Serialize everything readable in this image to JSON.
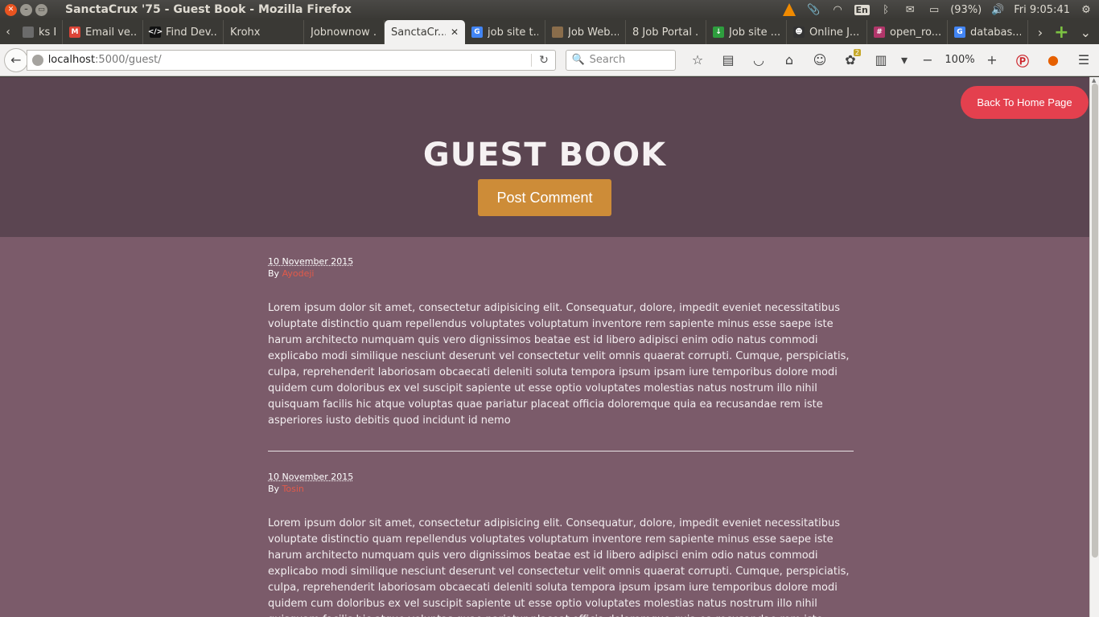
{
  "window": {
    "title": "SanctaCrux '75 - Guest Book - Mozilla Firefox"
  },
  "tray": {
    "keyboard": "En",
    "battery": "(93%)",
    "clock": "Fri  9:05:41"
  },
  "tabs": [
    {
      "label": "ks F...",
      "favicon_color": "#6b6b6b",
      "favicon_text": ""
    },
    {
      "label": "Email ve...",
      "favicon_color": "#db4437",
      "favicon_text": "M"
    },
    {
      "label": "Find Dev...",
      "favicon_color": "#111111",
      "favicon_text": "</>"
    },
    {
      "label": "Krohx",
      "favicon_color": "",
      "favicon_text": ""
    },
    {
      "label": "Jobnownow ...",
      "favicon_color": "",
      "favicon_text": ""
    },
    {
      "label": "SanctaCr...",
      "favicon_color": "",
      "favicon_text": "",
      "active": true
    },
    {
      "label": "job site t...",
      "favicon_color": "#4285f4",
      "favicon_text": "G"
    },
    {
      "label": "Job Web...",
      "favicon_color": "#8a6d4b",
      "favicon_text": ""
    },
    {
      "label": "8 Job Portal ...",
      "favicon_color": "",
      "favicon_text": ""
    },
    {
      "label": "Job site ...",
      "favicon_color": "#2e9e3e",
      "favicon_text": "↓"
    },
    {
      "label": "Online J...",
      "favicon_color": "#333333",
      "favicon_text": "☻"
    },
    {
      "label": "open_ro...",
      "favicon_color": "#b1366a",
      "favicon_text": "#"
    },
    {
      "label": "databas...",
      "favicon_color": "#4285f4",
      "favicon_text": "G"
    }
  ],
  "navbar": {
    "url_host": "localhost",
    "url_path": ":5000/guest/",
    "search_placeholder": "Search",
    "zoom": "100%",
    "addon_badge": "2"
  },
  "page": {
    "home_button": "Back To Home Page",
    "title": "GUEST BOOK",
    "post_button": "Post Comment",
    "colors": {
      "hero_bg": "#5b4551",
      "page_bg": "#7b5b6a",
      "home_button": "#e4404e",
      "post_button": "#cd8c38",
      "author_link": "#e25a4a"
    },
    "comments": [
      {
        "date": "10 November 2015",
        "by": "By",
        "author": "Ayodeji",
        "body": "Lorem ipsum dolor sit amet, consectetur adipisicing elit. Consequatur, dolore, impedit eveniet necessitatibus voluptate distinctio quam repellendus voluptates voluptatum inventore rem sapiente minus esse saepe iste harum architecto numquam quis vero dignissimos beatae est id libero adipisci enim odio natus commodi explicabo modi similique nesciunt deserunt vel consectetur velit omnis quaerat corrupti. Cumque, perspiciatis, culpa, reprehenderit laboriosam obcaecati deleniti soluta tempora ipsum ipsam iure temporibus dolore modi quidem cum doloribus ex vel suscipit sapiente ut esse optio voluptates molestias natus nostrum illo nihil quisquam facilis hic atque voluptas quae pariatur placeat officia doloremque quia ea recusandae rem iste asperiores iusto debitis quod incidunt id nemo"
      },
      {
        "date": "10 November 2015",
        "by": "By",
        "author": "Tosin",
        "body": "Lorem ipsum dolor sit amet, consectetur adipisicing elit. Consequatur, dolore, impedit eveniet necessitatibus voluptate distinctio quam repellendus voluptates voluptatum inventore rem sapiente minus esse saepe iste harum architecto numquam quis vero dignissimos beatae est id libero adipisci enim odio natus commodi explicabo modi similique nesciunt deserunt vel consectetur velit omnis quaerat corrupti. Cumque, perspiciatis, culpa, reprehenderit laboriosam obcaecati deleniti soluta tempora ipsum ipsam iure temporibus dolore modi quidem cum doloribus ex vel suscipit sapiente ut esse optio voluptates molestias natus nostrum illo nihil quisquam facilis hic atque voluptas quae pariatur placeat officia doloremque quia ea recusandae rem iste asperiores iusto debitis"
      }
    ]
  }
}
